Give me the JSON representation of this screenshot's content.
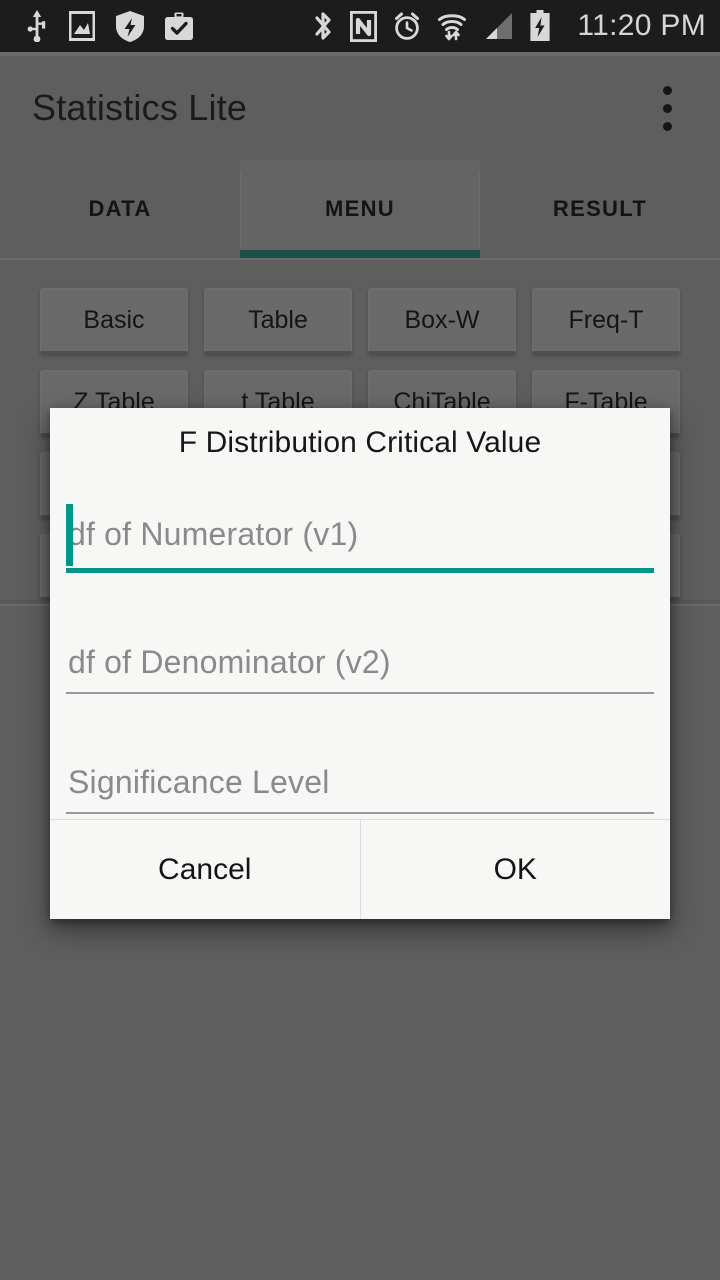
{
  "status_bar": {
    "time": "11:20 PM",
    "left_icons": [
      "usb-icon",
      "image-icon",
      "shield-icon",
      "briefcase-check-icon"
    ],
    "right_icons": [
      "bluetooth-icon",
      "nfc-icon",
      "alarm-icon",
      "wifi-icon",
      "signal-icon",
      "battery-charging-icon"
    ],
    "background_color": "#1c1c1c",
    "icon_color": "#d6d6d6"
  },
  "app_bar": {
    "title": "Statistics Lite",
    "overflow_icon": "overflow-menu-icon"
  },
  "tabs": {
    "selected_index": 1,
    "items": [
      {
        "label": "DATA"
      },
      {
        "label": "MENU"
      },
      {
        "label": "RESULT"
      }
    ],
    "indicator_color": "#009688"
  },
  "menu_grid": {
    "rows": [
      [
        {
          "label": "Basic"
        },
        {
          "label": "Table"
        },
        {
          "label": "Box-W"
        },
        {
          "label": "Freq-T"
        }
      ],
      [
        {
          "label": "Z Table"
        },
        {
          "label": "t Table"
        },
        {
          "label": "ChiTable"
        },
        {
          "label": "F-Table"
        }
      ]
    ]
  },
  "dialog": {
    "title": "F Distribution Critical Value",
    "fields": [
      {
        "placeholder": "df of Numerator (v1)",
        "value": "",
        "focused": true
      },
      {
        "placeholder": "df of Denominator (v2)",
        "value": "",
        "focused": false
      },
      {
        "placeholder": "Significance Level",
        "value": "",
        "focused": false
      }
    ],
    "cancel_label": "Cancel",
    "ok_label": "OK",
    "accent_color": "#009688",
    "background_color": "#f7f7f5"
  }
}
